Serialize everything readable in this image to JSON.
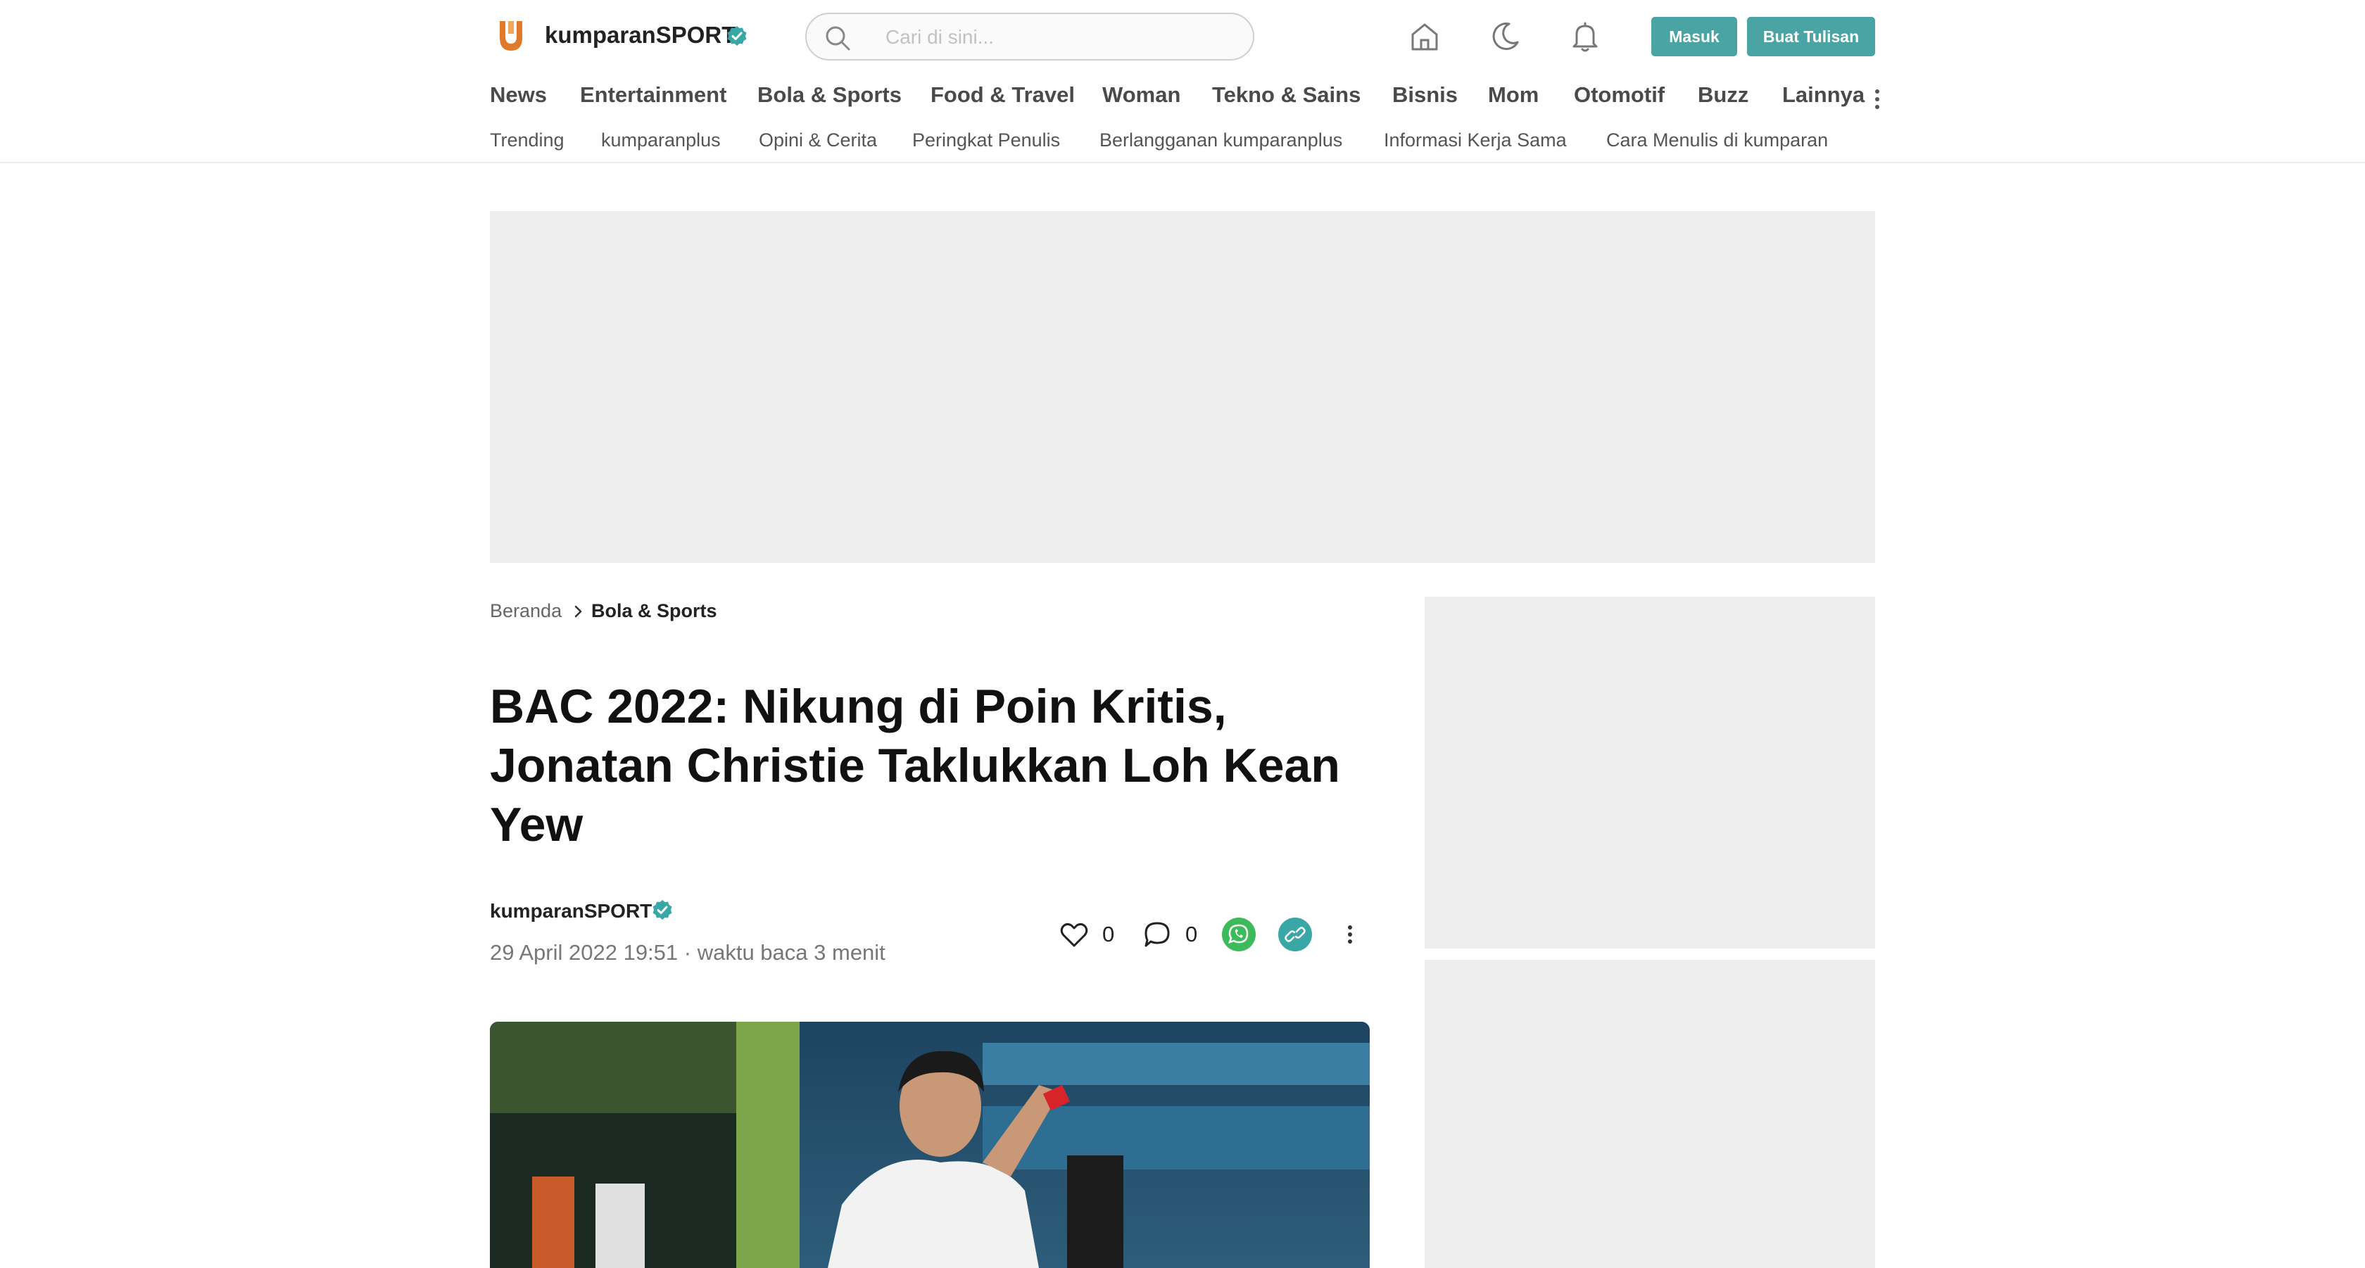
{
  "header": {
    "brand": "kumparanSPORT",
    "search_placeholder": "Cari di sini...",
    "login_label": "Masuk",
    "write_label": "Buat Tulisan",
    "icons": [
      "home-icon",
      "dark-mode-moon-icon",
      "notification-bell-icon"
    ]
  },
  "categories": [
    "News",
    "Entertainment",
    "Bola & Sports",
    "Food & Travel",
    "Woman",
    "Tekno & Sains",
    "Bisnis",
    "Mom",
    "Otomotif",
    "Buzz",
    "Lainnya"
  ],
  "subnav": [
    "Trending",
    "kumparanplus",
    "Opini & Cerita",
    "Peringkat Penulis",
    "Berlangganan kumparanplus",
    "Informasi Kerja Sama",
    "Cara Menulis di kumparan"
  ],
  "breadcrumb": {
    "home": "Beranda",
    "current": "Bola & Sports"
  },
  "article": {
    "title": "BAC 2022: Nikung di Poin Kritis, Jonatan Christie Taklukkan Loh Kean Yew",
    "author": "kumparanSPORT",
    "meta": "29 April 2022 19:51 · waktu baca 3 menit",
    "likes": "0",
    "comments": "0"
  },
  "colors": {
    "accent": "#4ba4a4",
    "verified": "#3aa7a7",
    "whatsapp": "#3dbb5b",
    "ad_placeholder": "#eeeeee",
    "logo_orange": "#e07a2a"
  }
}
